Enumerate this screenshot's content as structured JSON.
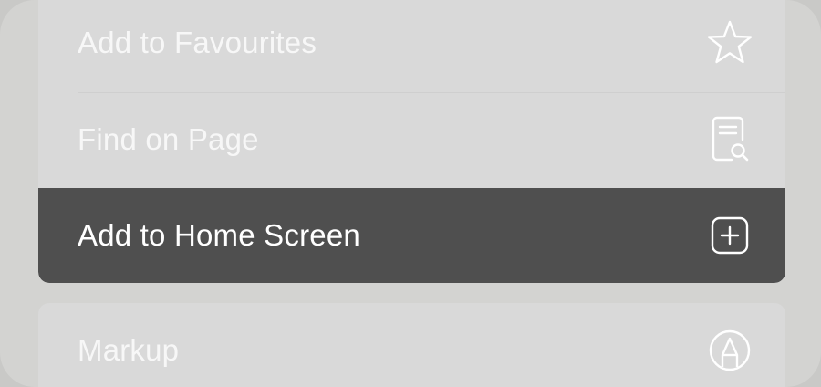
{
  "menu": {
    "items": [
      {
        "label": "Add to Favourites",
        "icon": "star-icon"
      },
      {
        "label": "Find on Page",
        "icon": "find-on-page-icon"
      },
      {
        "label": "Add to Home Screen",
        "icon": "add-square-icon",
        "highlighted": true
      }
    ],
    "secondary": [
      {
        "label": "Markup",
        "icon": "markup-pen-icon"
      }
    ]
  },
  "colors": {
    "sheet_bg": "#d3d3d1",
    "row_bg": "#d9d9d9",
    "highlight_bg": "#4f4f4f",
    "text": "#f7f7f7"
  }
}
